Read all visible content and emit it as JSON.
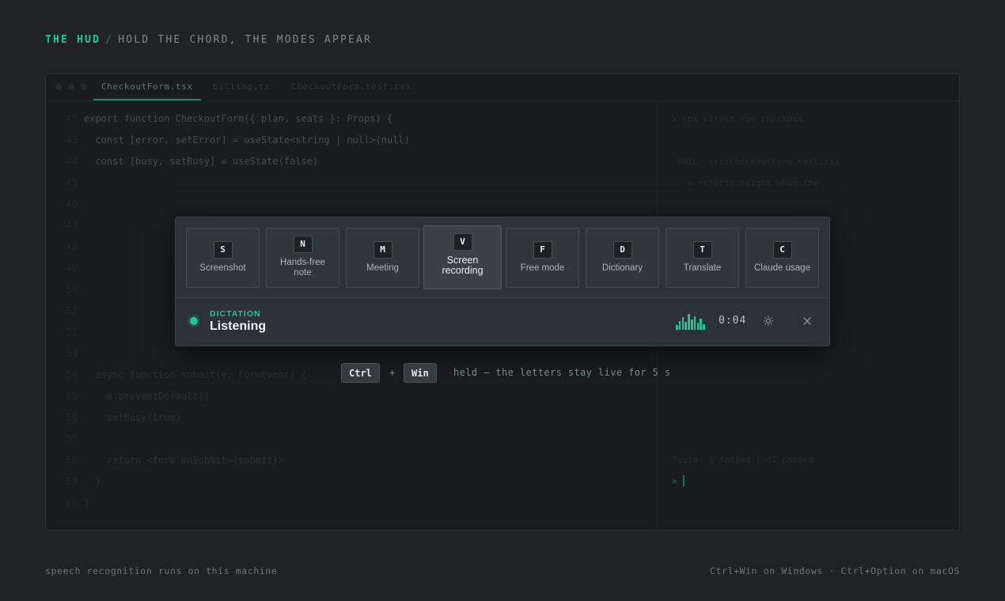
{
  "header": {
    "title_accent": "THE HUD",
    "separator": "/",
    "subtitle": "HOLD THE CHORD, THE MODES APPEAR"
  },
  "editor": {
    "tabs": [
      {
        "label": "CheckoutForm.tsx",
        "active": true
      },
      {
        "label": "billing.ts",
        "active": false
      },
      {
        "label": "CheckoutForm.test.tsx",
        "active": false
      }
    ],
    "line_numbers": [
      "42",
      "43",
      "44",
      "45",
      "46",
      "47",
      "48",
      "49",
      "50",
      "51",
      "52",
      "53",
      "54",
      "55",
      "56",
      "57",
      "58",
      "59",
      "60"
    ],
    "code_top": [
      "export function CheckoutForm({ plan, seats }: Props) {",
      "  const [error, setError] = useState<string | null>(null)",
      "  const [busy, setBusy] = useState(false)"
    ],
    "code_bottom": [
      "  async function submit(e: FormEvent) {",
      "    e.preventDefault()",
      "    setBusy(true)",
      "",
      "    return <form onSubmit={submit}>",
      "  }",
      "}"
    ]
  },
  "terminal": {
    "command": "> npx vitest run checkout",
    "fail_line": " FAIL  src/CheckoutForm.test.tsx",
    "detail_line": "   > rejects height when the",
    "summary": "Tests  1 failed | 42 passed",
    "prompt": ">"
  },
  "hud": {
    "modes": [
      {
        "key": "S",
        "label": "Screenshot",
        "selected": false
      },
      {
        "key": "N",
        "label": "Hands-free note",
        "selected": false
      },
      {
        "key": "M",
        "label": "Meeting",
        "selected": false
      },
      {
        "key": "V",
        "label": "Screen recording",
        "selected": true
      },
      {
        "key": "F",
        "label": "Free mode",
        "selected": false
      },
      {
        "key": "D",
        "label": "Dictionary",
        "selected": false
      },
      {
        "key": "T",
        "label": "Translate",
        "selected": false
      },
      {
        "key": "C",
        "label": "Claude usage",
        "selected": false
      }
    ],
    "status": {
      "kicker": "DICTATION",
      "title": "Listening",
      "timer": "0:04",
      "level_bars": [
        0.3,
        0.55,
        0.8,
        0.5,
        1.0,
        0.65,
        0.85,
        0.45,
        0.7,
        0.35
      ],
      "accent_color": "#22c49a"
    },
    "icons": {
      "settings": "gear-icon",
      "close": "close-icon"
    }
  },
  "hint": {
    "key1": "Ctrl",
    "plus": "+",
    "key2": "Win",
    "text": "held — the letters stay live for 5 s"
  },
  "footer": {
    "left": "speech recognition runs on this machine",
    "right": "Ctrl+Win on Windows · Ctrl+Option on macOS"
  }
}
